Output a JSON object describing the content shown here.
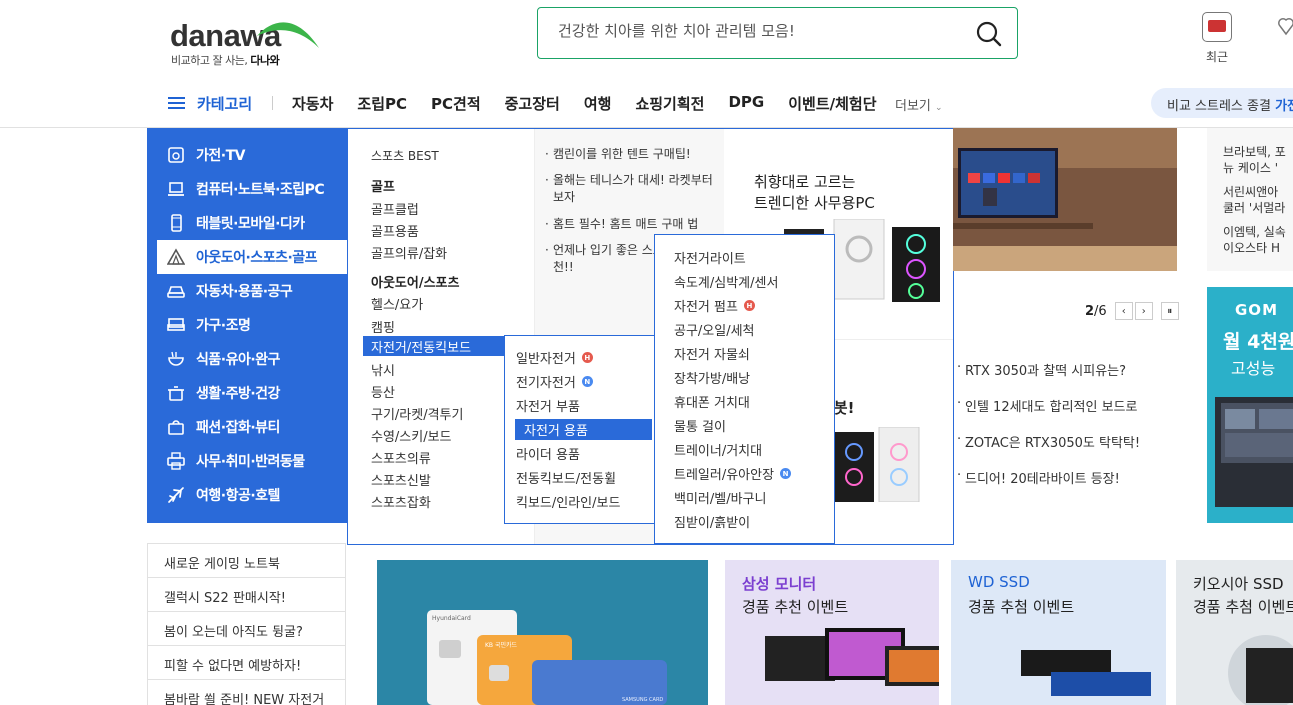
{
  "logo": {
    "wordmark": "danawa",
    "tagline_prefix": "비교하고 잘 사는, ",
    "tagline_bold": "다나와"
  },
  "search": {
    "placeholder": "건강한 치아를 위한 치아 관리템 모음!"
  },
  "util": {
    "recent_label": "최근"
  },
  "gnb": {
    "category_label": "카테고리",
    "menu": [
      "자동차",
      "조립PC",
      "PC견적",
      "중고장터",
      "여행",
      "쇼핑기획전",
      "DPG",
      "이벤트/체험단"
    ],
    "more_label": "더보기",
    "banner_text": "비교 스트레스 종결 ",
    "banner_accent": "가전"
  },
  "categories": [
    {
      "label": "가전·TV",
      "icon": "tv-icon"
    },
    {
      "label": "컴퓨터·노트북·조립PC",
      "icon": "computer-icon"
    },
    {
      "label": "태블릿·모바일·디카",
      "icon": "mobile-icon"
    },
    {
      "label": "아웃도어·스포츠·골프",
      "icon": "tent-icon"
    },
    {
      "label": "자동차·용품·공구",
      "icon": "car-icon"
    },
    {
      "label": "가구·조명",
      "icon": "sofa-icon"
    },
    {
      "label": "식품·유아·완구",
      "icon": "bowl-icon"
    },
    {
      "label": "생활·주방·건강",
      "icon": "pot-icon"
    },
    {
      "label": "패션·잡화·뷰티",
      "icon": "bag-icon"
    },
    {
      "label": "사무·취미·반려동물",
      "icon": "printer-icon"
    },
    {
      "label": "여행·항공·호텔",
      "icon": "plane-icon"
    }
  ],
  "mega": {
    "best_label": "스포츠 BEST",
    "golf_head": "골프",
    "golf_items": [
      "골프클럽",
      "골프용품",
      "골프의류/잡화"
    ],
    "outdoor_head": "아웃도어/스포츠",
    "outdoor_items": [
      "헬스/요가",
      "캠핑",
      "자전거/전동킥보드",
      "낚시",
      "등산",
      "구기/라켓/격투기",
      "수영/스키/보드",
      "스포츠의류",
      "스포츠신발",
      "스포츠잡화"
    ],
    "tips": [
      "캠린이를 위한 텐트 구매팁!",
      "올해는 테니스가 대세! 라켓부터 보자",
      "홈트 필수! 홈트 매트 구매 법",
      "언제나 입기 좋은 스포츠 의류 추천!!"
    ],
    "promo_title_1": "취향대로 고르는",
    "promo_title_2": "트렌디한 사무용PC",
    "promo2_title": "로봇!"
  },
  "flyout1": {
    "items": [
      {
        "label": "일반자전거",
        "badge": "H"
      },
      {
        "label": "전기자전거",
        "badge": "N"
      },
      {
        "label": "자전거 부품",
        "badge": ""
      },
      {
        "label": "자전거 용품",
        "badge": ""
      },
      {
        "label": "라이더 용품",
        "badge": ""
      },
      {
        "label": "전동킥보드/전동휠",
        "badge": ""
      },
      {
        "label": "킥보드/인라인/보드",
        "badge": ""
      }
    ]
  },
  "flyout2": {
    "items": [
      {
        "label": "자전거라이트",
        "badge": ""
      },
      {
        "label": "속도계/심박계/센서",
        "badge": ""
      },
      {
        "label": "자전거 펌프",
        "badge": "H"
      },
      {
        "label": "공구/오일/세척",
        "badge": ""
      },
      {
        "label": "자전거 자물쇠",
        "badge": ""
      },
      {
        "label": "장착가방/배낭",
        "badge": ""
      },
      {
        "label": "휴대폰 거치대",
        "badge": ""
      },
      {
        "label": "물통 걸이",
        "badge": ""
      },
      {
        "label": "트레이너/거치대",
        "badge": ""
      },
      {
        "label": "트레일러/유아안장",
        "badge": "N"
      },
      {
        "label": "백미러/벨/바구니",
        "badge": ""
      },
      {
        "label": "짐받이/흙받이",
        "badge": ""
      }
    ]
  },
  "hero": {
    "pager_current": "2",
    "pager_total": "/6"
  },
  "news": [
    "RTX 3050과 찰떡 시피유는?",
    "인텔 12세대도 합리적인 보드로",
    "ZOTAC은 RTX3050도 탁탁탁!",
    "드디어! 20테라바이트 등장!"
  ],
  "side_news": [
    "브라보텍, 포",
    "뉴 케이스 '",
    "서린씨앤아",
    "쿨러 '서멀라",
    "이엠텍, 실속",
    "이오스타 H"
  ],
  "gom_banner": {
    "brand": "GOM",
    "line1": "월 4천원",
    "line2": "고성능"
  },
  "left_links": [
    "새로운 게이밍 노트북",
    "갤럭시 S22 판매시작!",
    "봄이 오는데 아직도 뒹굴?",
    "피할 수 없다면 예방하자!",
    "봄바람 쐴 준비! NEW 자전거"
  ],
  "cards": [
    {
      "title": "",
      "subtitle": ""
    },
    {
      "title": "삼성 모니터",
      "subtitle": "경품 추천 이벤트",
      "title_color": "#7b3fd0"
    },
    {
      "title": "WD SSD",
      "subtitle": "경품 추첨 이벤트",
      "title_color": "#1f63d4"
    },
    {
      "title": "키오시아 SSD",
      "subtitle": "경품 추첨 이벤트",
      "title_color": "#222222"
    }
  ],
  "card_print": {
    "card1_brand": "KB 국민카드",
    "card2_brand": "SAMSUNG CARD",
    "card3_brand": "HyundaiCard"
  }
}
